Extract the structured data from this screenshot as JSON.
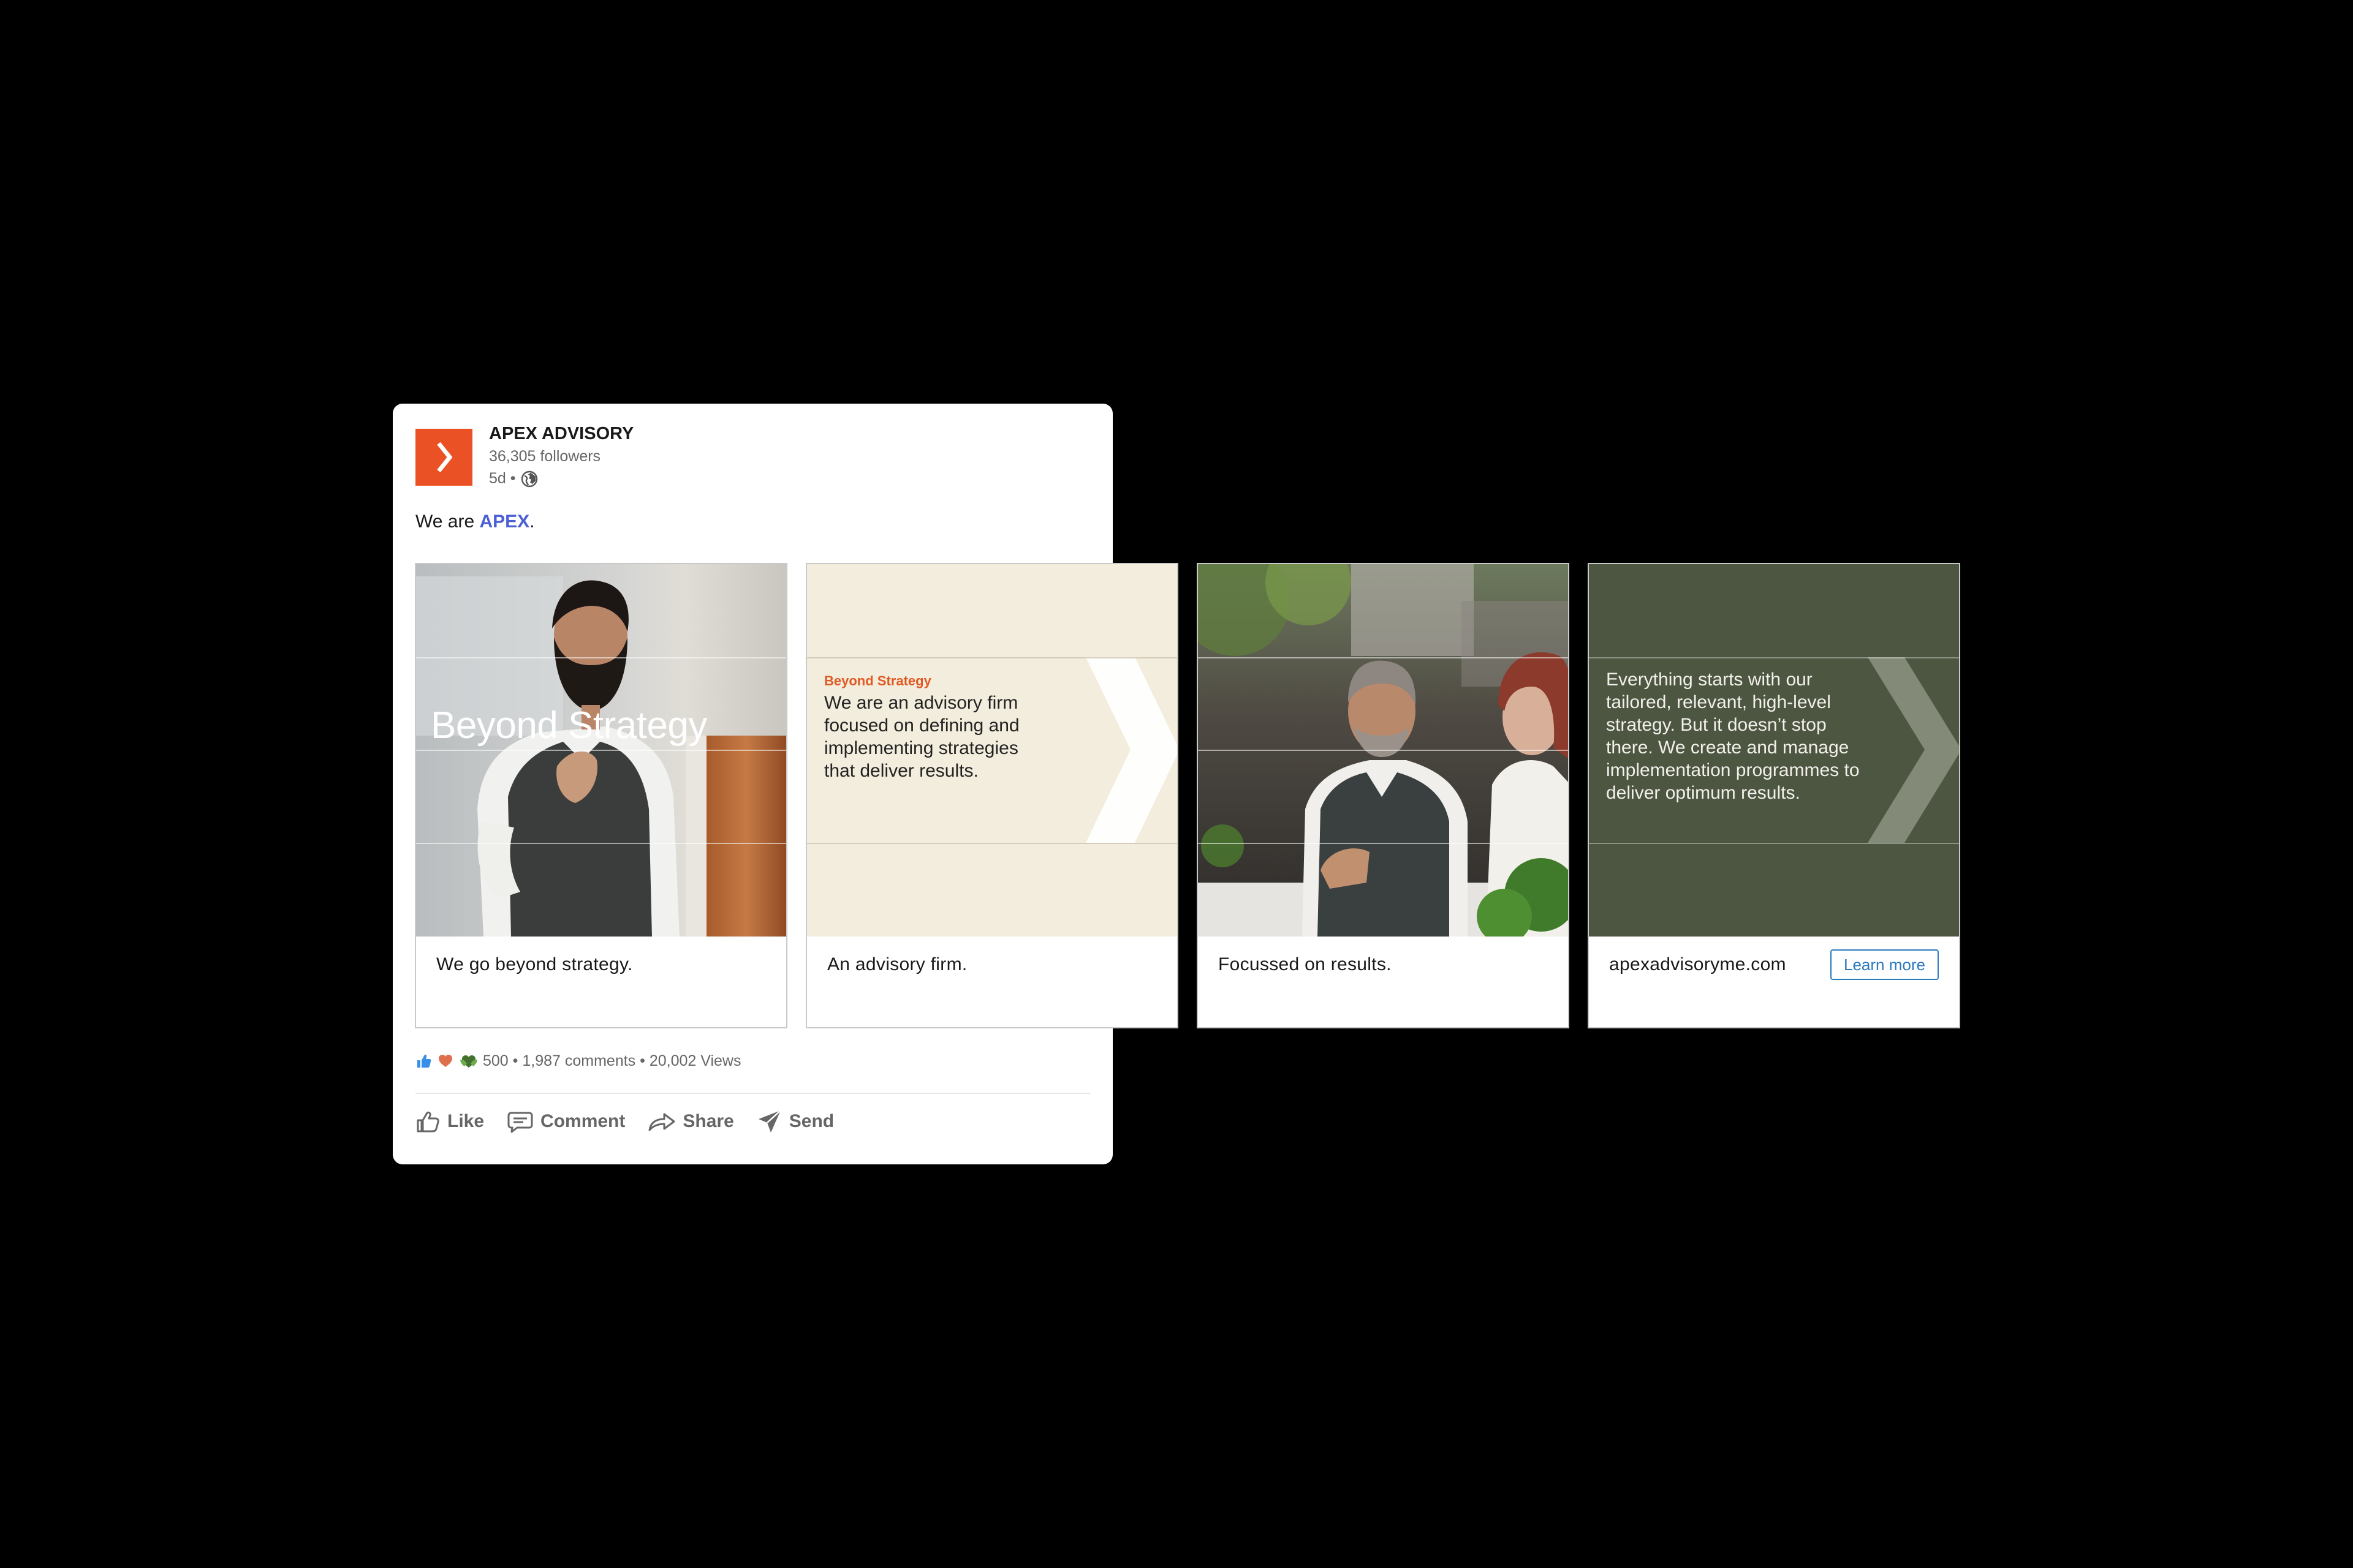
{
  "post": {
    "company_name": "APEX ADVISORY",
    "followers": "36,305 followers",
    "age": "5d •",
    "text_prefix": "We are ",
    "mention": "APEX",
    "text_suffix": "."
  },
  "slides": [
    {
      "title": "Beyond Strategy",
      "caption": "We go beyond strategy."
    },
    {
      "kicker": "Beyond Strategy",
      "body": "We are an advisory firm focused on defining and implementing strategies that deliver results.",
      "caption": "An advisory firm."
    },
    {
      "caption": "Focussed on results."
    },
    {
      "body": "Everything starts with our tailored, relevant, high-level strategy. But it doesn’t stop there. We create and manage implementation programmes to deliver optimum results.",
      "caption": "apexadvisoryme.com",
      "cta": "Learn more"
    }
  ],
  "social": {
    "stats": "500 • 1,987 comments • 20,002 Views"
  },
  "actions": {
    "like": "Like",
    "comment": "Comment",
    "share": "Share",
    "send": "Send"
  },
  "colors": {
    "page_background": "#000000",
    "brand_orange": "#ea5124",
    "mention_blue": "#4b5fd4",
    "cream_slide": "#f3eddd",
    "olive_slide": "#4d5641",
    "link_blue": "#2a7ac0"
  },
  "icons": [
    "apex-logo-icon",
    "globe-icon",
    "like-reaction-icon",
    "love-reaction-icon",
    "support-reaction-icon",
    "like-icon",
    "comment-icon",
    "share-icon",
    "send-icon"
  ]
}
